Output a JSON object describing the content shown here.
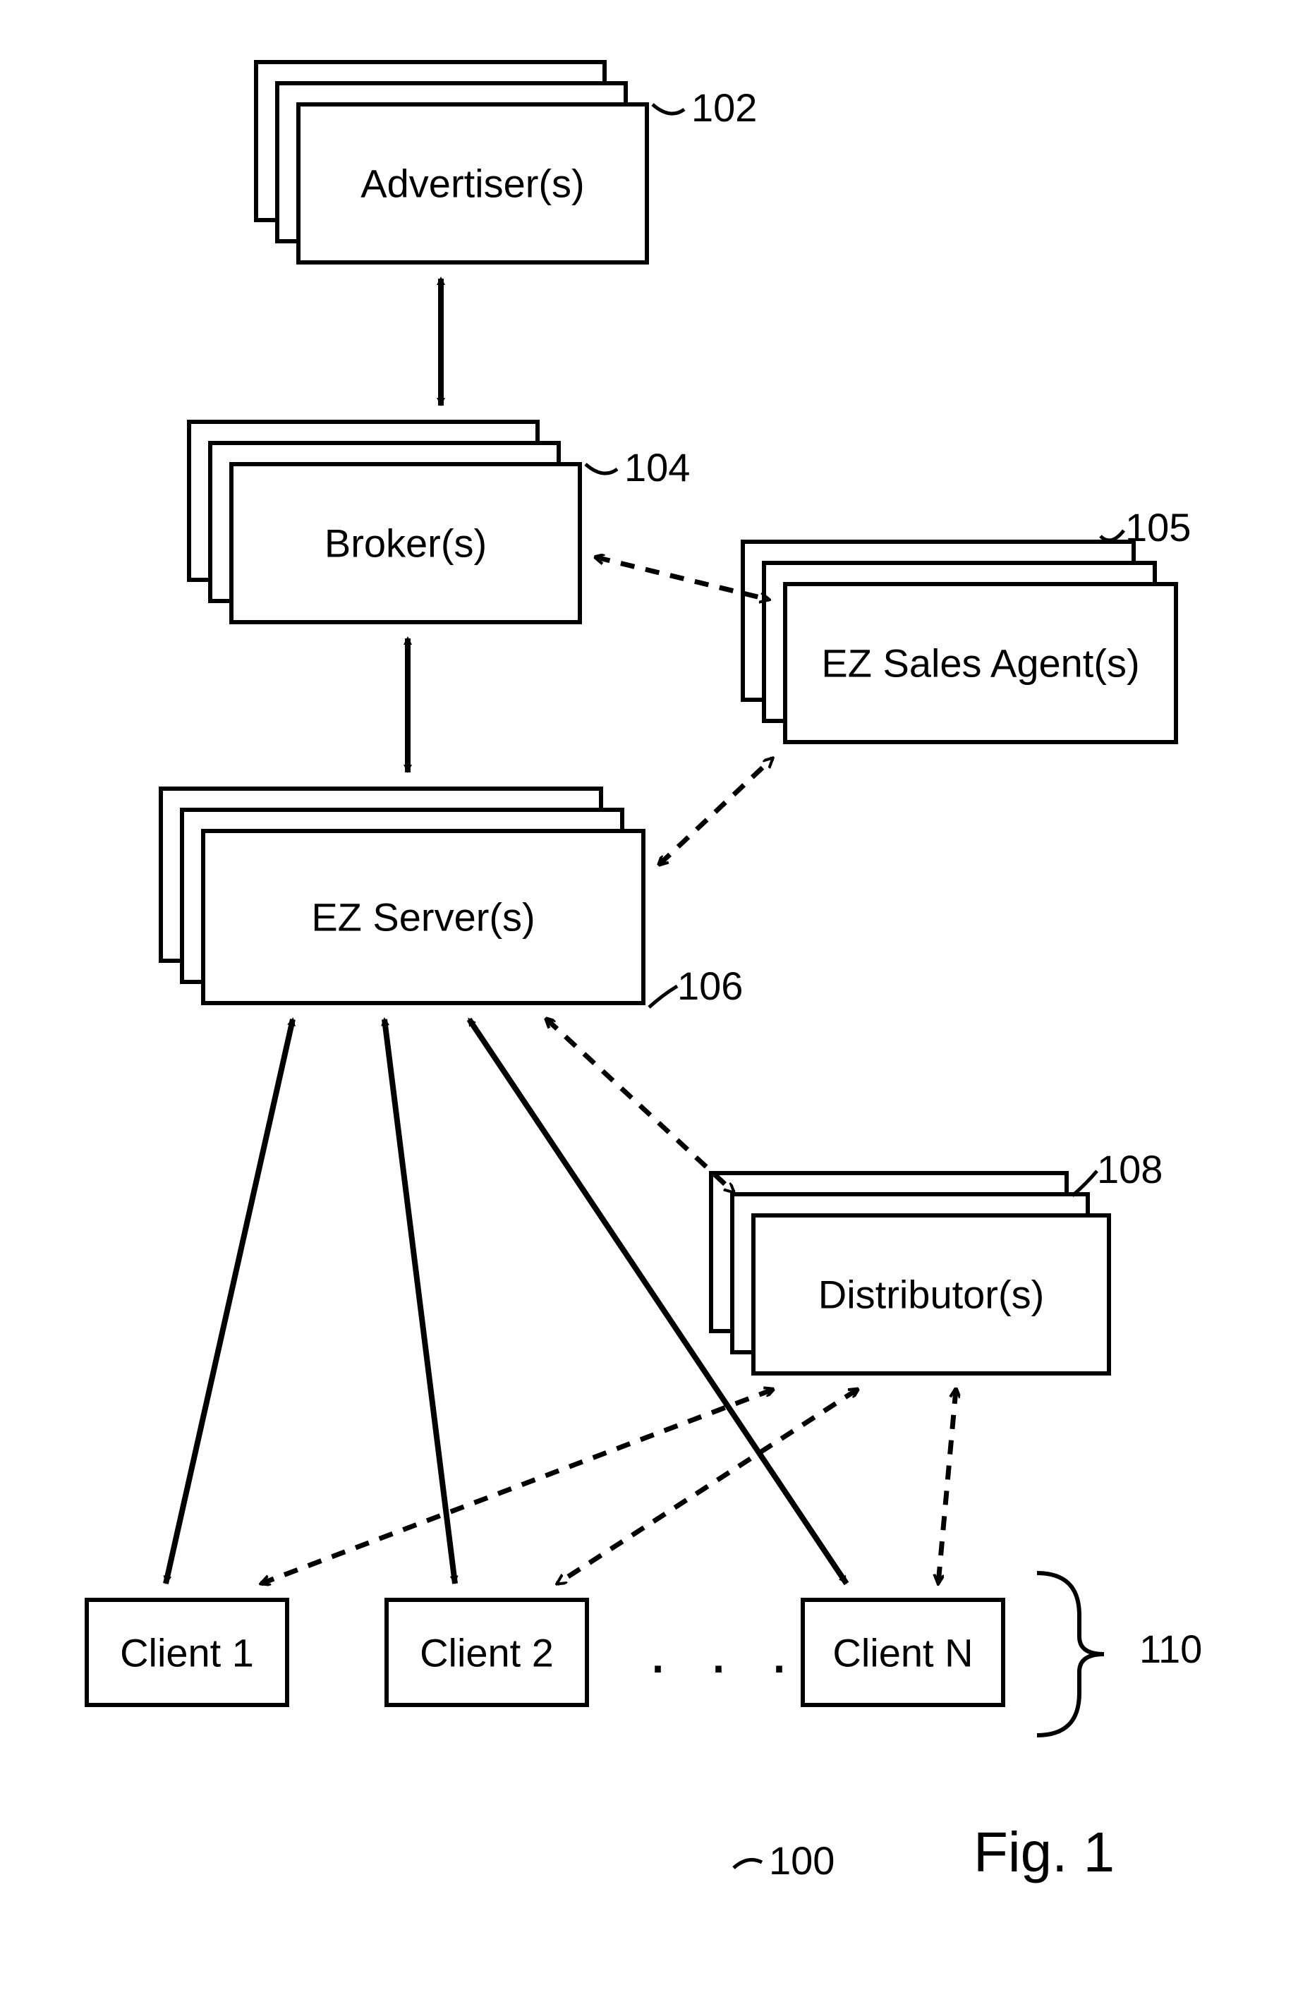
{
  "nodes": {
    "advertiser": {
      "label": "Advertiser(s)",
      "ref": "102"
    },
    "broker": {
      "label": "Broker(s)",
      "ref": "104"
    },
    "salesagent": {
      "label": "EZ Sales Agent(s)",
      "ref": "105"
    },
    "server": {
      "label": "EZ Server(s)",
      "ref": "106"
    },
    "distributor": {
      "label": "Distributor(s)",
      "ref": "108"
    },
    "client1": {
      "label": "Client 1"
    },
    "client2": {
      "label": "Client 2"
    },
    "clientN": {
      "label": "Client N"
    },
    "clients_ref": "110",
    "ellipsis": ". . .",
    "fig_ref": "100",
    "fig_label": "Fig. 1"
  },
  "edges": [
    {
      "from": "advertiser",
      "to": "broker",
      "style": "solid",
      "bidir": true
    },
    {
      "from": "broker",
      "to": "server",
      "style": "solid",
      "bidir": true
    },
    {
      "from": "broker",
      "to": "salesagent",
      "style": "dashed",
      "bidir": true
    },
    {
      "from": "server",
      "to": "salesagent",
      "style": "dashed",
      "bidir": true
    },
    {
      "from": "server",
      "to": "client1",
      "style": "solid",
      "bidir": true
    },
    {
      "from": "server",
      "to": "client2",
      "style": "solid",
      "bidir": true
    },
    {
      "from": "server",
      "to": "clientN",
      "style": "solid",
      "bidir": true
    },
    {
      "from": "server",
      "to": "distributor",
      "style": "dashed",
      "bidir": true
    },
    {
      "from": "distributor",
      "to": "client1",
      "style": "dashed",
      "bidir": true
    },
    {
      "from": "distributor",
      "to": "client2",
      "style": "dashed",
      "bidir": true
    },
    {
      "from": "distributor",
      "to": "clientN",
      "style": "dashed",
      "bidir": true
    }
  ]
}
